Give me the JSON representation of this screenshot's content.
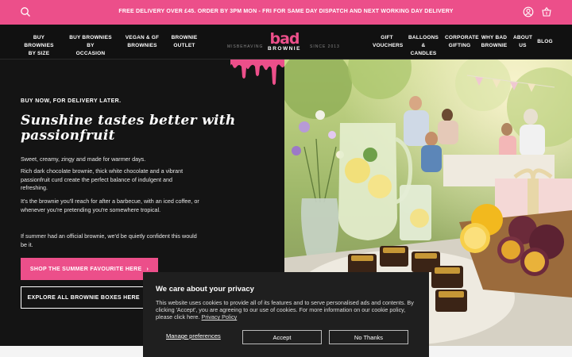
{
  "topbar": {
    "message": "FREE DELIVERY OVER £45. ORDER BY 3PM MON - FRI FOR SAME DAY DISPATCH AND NEXT WORKING DAY DELIVERY",
    "icons": [
      "search-icon",
      "account-icon",
      "basket-icon"
    ]
  },
  "nav": {
    "left": [
      {
        "l1": "BUY BROWNIES",
        "l2": "BY SIZE"
      },
      {
        "l1": "BUY BROWNIES BY",
        "l2": "OCCASION"
      },
      {
        "l1": "VEGAN & GF",
        "l2": "BROWNIES"
      },
      {
        "l1": "BROWNIE",
        "l2": "OUTLET"
      }
    ],
    "right": [
      {
        "l1": "GIFT",
        "l2": "VOUCHERS"
      },
      {
        "l1": "BALLOONS",
        "l2": "& CANDLES"
      },
      {
        "l1": "CORPORATE",
        "l2": "GIFTING"
      },
      {
        "l1": "WHY BAD",
        "l2": "BROWNIE"
      },
      {
        "l1": "ABOUT",
        "l2": "US"
      },
      {
        "l1": "BLOG",
        "l2": ""
      }
    ],
    "logo_top": "bad",
    "logo_bottom": "BROWNIE",
    "tag_left": "MISBEHAVING",
    "tag_right": "SINCE 2013"
  },
  "hero": {
    "kicker": "BUY NOW, FOR DELIVERY LATER.",
    "headline": "Sunshine tastes better with passionfruit",
    "p1": "Sweet, creamy, zingy and made for warmer days.",
    "p2": "Rich dark chocolate brownie, thick white chocolate and a vibrant passionfruit curd create the perfect balance of indulgent and refreshing.",
    "p3": "It's the brownie you'll reach for after a barbecue, with an iced coffee, or whenever you're pretending you're somewhere tropical.",
    "p4": "If summer had an official brownie, we'd be quietly confident this would be it.",
    "btn_primary": "SHOP THE SUMMER FAVOURITE HERE",
    "btn_secondary": "EXPLORE ALL BROWNIE BOXES HERE"
  },
  "cookie": {
    "title": "We care about your privacy",
    "text": "This website uses cookies to provide all of its features and to serve personalised ads and contents. By clicking 'Accept', you are agreeing to our use of cookies. For more information on our cookie policy, please click here.",
    "link": "Privacy Policy",
    "manage": "Manage preferences",
    "accept": "Accept",
    "decline": "No Thanks"
  },
  "colors": {
    "brand_pink": "#ec4f8a",
    "dark": "#141414"
  }
}
